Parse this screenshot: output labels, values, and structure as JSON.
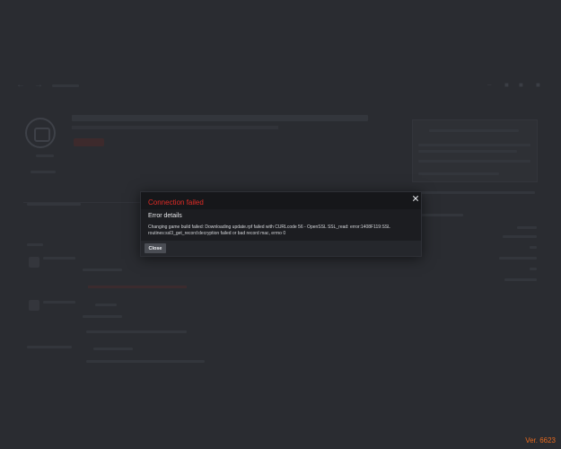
{
  "modal": {
    "title": "Connection failed",
    "heading": "Error details",
    "message": "Changing game build failed: Downloading update.rpf failed with CURLcode 56 - OpenSSL SSL_read: error:1408F119:SSL routines:ssl3_get_record:decryption failed or bad record mac, errno 0",
    "close_label": "Close",
    "close_icon": "close-icon"
  },
  "version": "Ver. 6623",
  "colors": {
    "title": "#e02b25",
    "version": "#e86a1e",
    "backdrop": "#2a2c31",
    "modal_bg": "#1c1d21",
    "button_bg": "#4a4d54"
  }
}
